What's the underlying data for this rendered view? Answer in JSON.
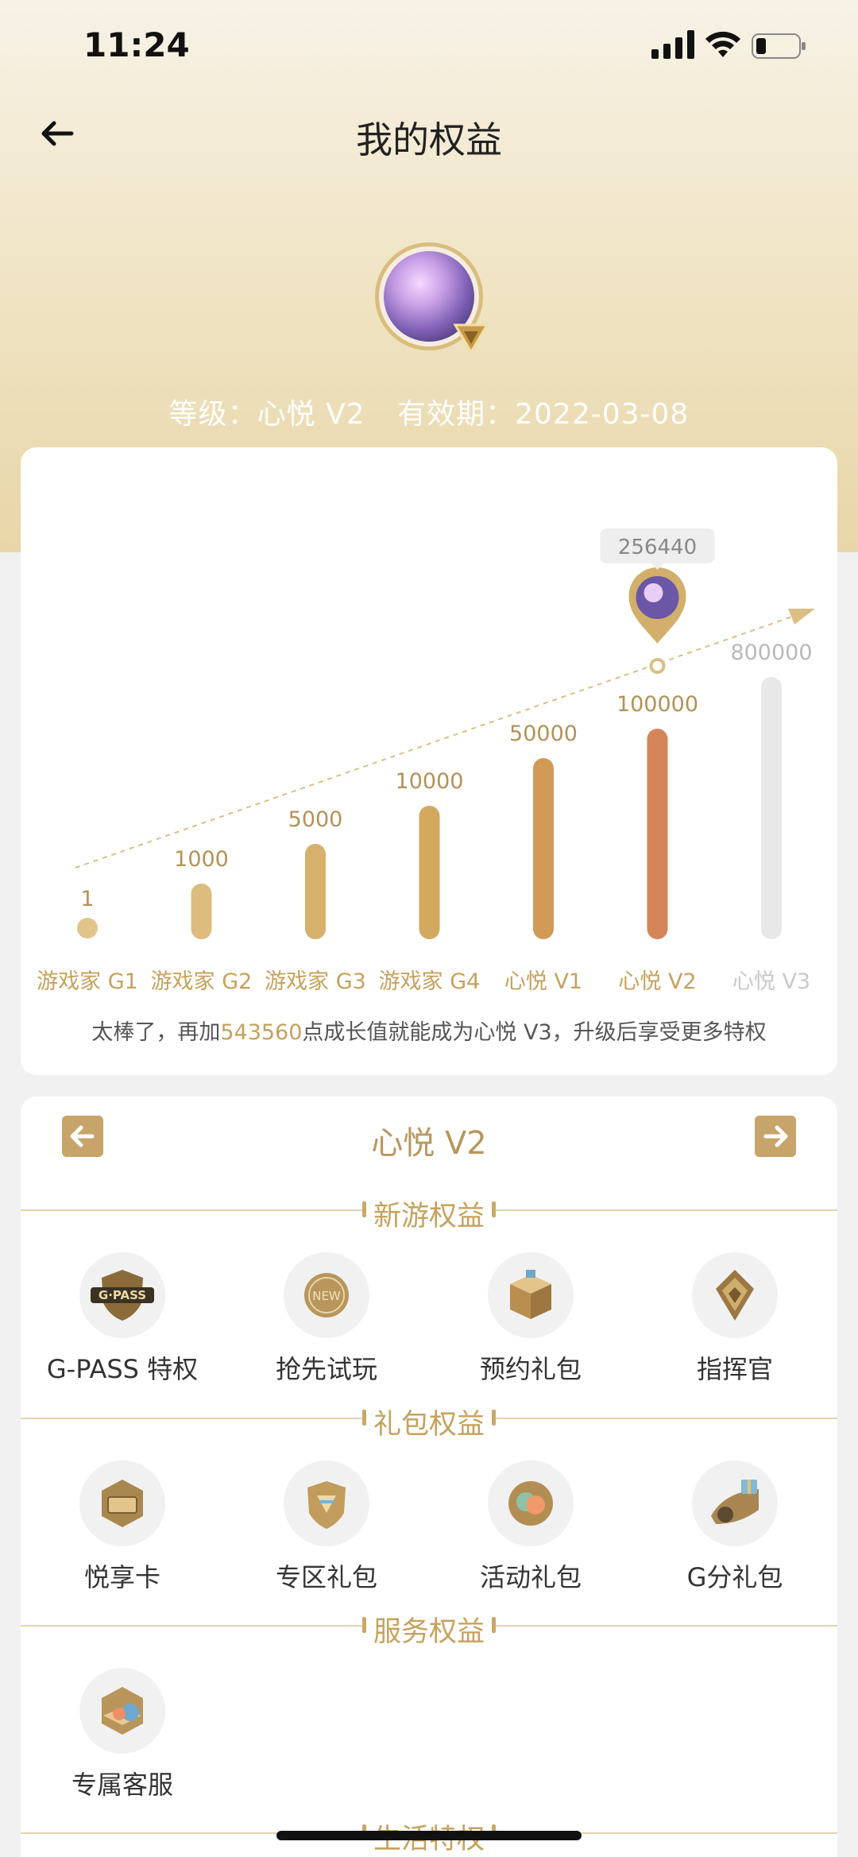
{
  "status_bar": {
    "time": "11:24"
  },
  "header": {
    "title": "我的权益"
  },
  "profile": {
    "level_label": "等级：心悦 V2",
    "expiry_label": "有效期：2022-03-08"
  },
  "chart_data": {
    "type": "bar",
    "categories": [
      "游戏家 G1",
      "游戏家 G2",
      "游戏家 G3",
      "游戏家 G4",
      "心悦 V1",
      "心悦 V2",
      "心悦 V3"
    ],
    "values": [
      1,
      1000,
      5000,
      10000,
      50000,
      100000,
      800000
    ],
    "value_labels": [
      "1",
      "1000",
      "5000",
      "10000",
      "50000",
      "100000",
      "800000"
    ],
    "current_value": 256440,
    "current_value_label": "256440",
    "current_level_index": 5,
    "colors": [
      "#e0c48a",
      "#dcbc7f",
      "#d7b16c",
      "#d2a95e",
      "#d19b57",
      "#d6845a",
      "#e8e8e8"
    ]
  },
  "progress_tip": {
    "prefix": "太棒了，再加",
    "points": "543560",
    "suffix": "点成长值就能成为心悦 V3，升级后享受更多特权"
  },
  "benefits": {
    "level_name": "心悦 V2",
    "sections": [
      {
        "title": "新游权益",
        "items": [
          {
            "label": "G-PASS 特权",
            "icon": "gpass-icon"
          },
          {
            "label": "抢先试玩",
            "icon": "new-badge-icon"
          },
          {
            "label": "预约礼包",
            "icon": "gift-box-icon"
          },
          {
            "label": "指挥官",
            "icon": "commander-icon"
          }
        ]
      },
      {
        "title": "礼包权益",
        "items": [
          {
            "label": "悦享卡",
            "icon": "card-icon"
          },
          {
            "label": "专区礼包",
            "icon": "zone-gift-icon"
          },
          {
            "label": "活动礼包",
            "icon": "event-gift-icon"
          },
          {
            "label": "G分礼包",
            "icon": "g-points-gift-icon"
          }
        ]
      },
      {
        "title": "服务权益",
        "items": [
          {
            "label": "专属客服",
            "icon": "customer-service-icon"
          }
        ]
      },
      {
        "title": "生活特权",
        "items": []
      }
    ]
  }
}
